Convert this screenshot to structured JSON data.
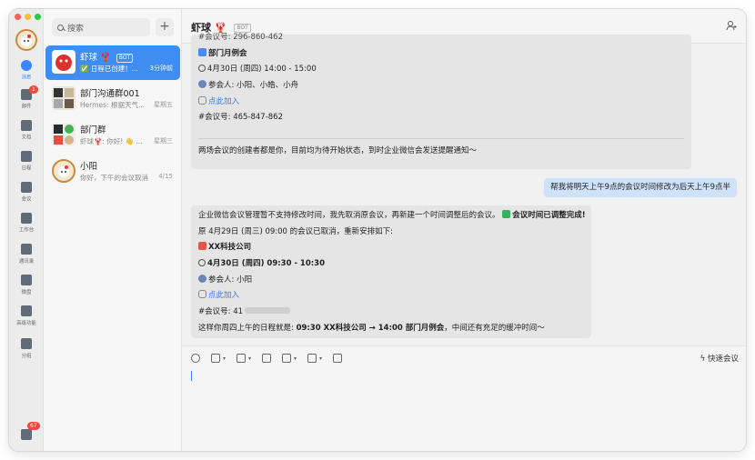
{
  "rail": {
    "items": [
      {
        "label": "消息"
      },
      {
        "label": "邮件",
        "badge": "1"
      },
      {
        "label": "文档"
      },
      {
        "label": "日程"
      },
      {
        "label": "会议"
      },
      {
        "label": "工作台"
      },
      {
        "label": "通讯录"
      },
      {
        "label": "微盘"
      },
      {
        "label": "高级功能"
      },
      {
        "label": "分组"
      }
    ],
    "bottom_badge": "67"
  },
  "sidebar": {
    "search_placeholder": "搜索",
    "add_label": "+",
    "conversations": [
      {
        "name": "虾球",
        "emoji": "🦞",
        "tag": "BOT",
        "preview": "✅ 日程已创建！...",
        "time": "3分钟前"
      },
      {
        "name": "部门沟通群001",
        "preview": "Hermes: 根据天气...",
        "time": "星期五"
      },
      {
        "name": "部门群",
        "preview": "虾球🦞: 你好! 👋 ...",
        "time": "星期三"
      },
      {
        "name": "小阳",
        "preview": "你好，下午的会议取消",
        "time": "4/15"
      }
    ]
  },
  "chat": {
    "title": "虾球",
    "title_emoji": "🦞",
    "tag": "BOT",
    "msg1": {
      "cut_line": "#会议号: 296-860-462",
      "meeting_title": "部门月例会",
      "meeting_time": "4月30日 (周四) 14:00 - 15:00",
      "attendees": "参会人: 小阳、小皓、小舟",
      "join_link": "点此加入",
      "meeting_id": "#会议号: 465-847-862",
      "note": "两场会议的创建者都是你，目前均为待开始状态，到时企业微信会发送提醒通知～"
    },
    "my_message": "帮我将明天上午9点的会议时间修改为后天上午9点半",
    "msg2": {
      "line1_prefix": "企业微信会议管理暂不支持修改时间，我先取消原会议，再新建一个时间调整后的会议。",
      "line1_bold": "会议时间已调整完成!",
      "line2": "原 4月29日 (周三) 09:00 的会议已取消，重新安排如下:",
      "company": "XX科技公司",
      "time": "4月30日 (周四) 09:30 - 10:30",
      "attendees": "参会人: 小阳",
      "join_link": "点此加入",
      "meeting_id": "#会议号: 41",
      "summary_prefix": "这样你周四上午的日程就是: ",
      "summary_bold": "09:30 XX科技公司 → 14:00 部门月例会",
      "summary_suffix": "，中间还有充足的缓冲时间～"
    },
    "quick_meeting": "快速会议"
  },
  "colors": {
    "accent": "#3f8cf2",
    "badge": "#f5463c",
    "my_bubble": "#cfe2fb",
    "bot_bubble": "#e5e5e5"
  }
}
